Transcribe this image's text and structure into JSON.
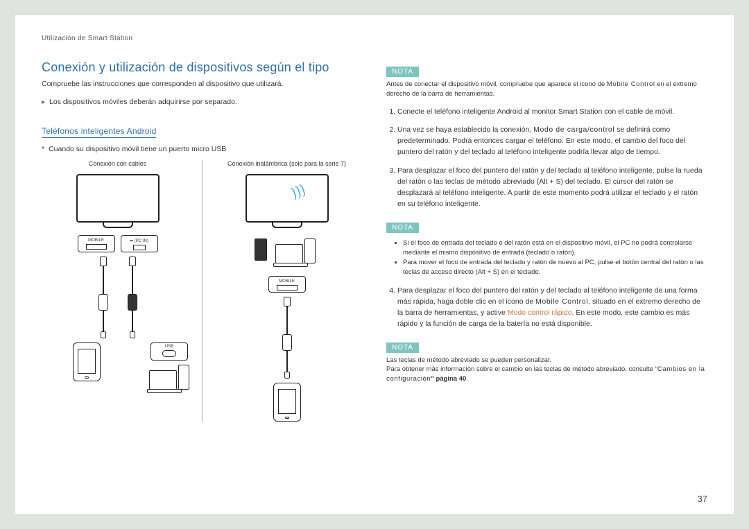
{
  "header": {
    "breadcrumb": "Utilización de Smart Station"
  },
  "left": {
    "title": "Conexión y utilización de dispositivos según el tipo",
    "intro": "Compruebe las instrucciones que corresponden al dispositivo que utilizará.",
    "bullet1": "Los dispositivos móviles deberán adquirirse por separado.",
    "sub_heading": "Teléfonos inteligentes Android",
    "star_note": "Cuando su dispositivo móvil tiene un puerto micro USB",
    "col1_caption": "Conexión con cables",
    "col2_caption": "Conexión inalámbrica (solo para la serie 7)",
    "port_mobile": "MOBILE",
    "port_pcin": "(PC IN)",
    "port_usb_icon": "⬌",
    "usb_label": "USB"
  },
  "right": {
    "note_label": "NOTA",
    "note1_a": "Antes de conectar el dispositivo móvil, compruebe que aparece el icono de ",
    "note1_b": "Mobile Control",
    "note1_c": " en el extremo derecho de la barra de herramientas.",
    "steps": {
      "s1": "Conecte el teléfono inteligente Android al monitor Smart Station con el cable de móvil.",
      "s2_a": "Una vez se haya establecido la conexión, ",
      "s2_b": "Modo de carga/control",
      "s2_c": " se definirá como predeterminado. Podrá entonces cargar el teléfono. En este modo, el cambio del foco del puntero del ratón y del teclado al teléfono inteligente podría llevar algo de tiempo.",
      "s3": "Para desplazar el foco del puntero del ratón y del teclado al teléfono inteligente, pulse la rueda del ratón o las teclas de método abreviado (Alt + S) del teclado. El cursor del ratón se desplazará al teléfono inteligente. A partir de este momento podrá utilizar el teclado y el ratón en su teléfono inteligente.",
      "s4_a": "Para desplazar el foco del puntero del ratón y del teclado al teléfono inteligente de una forma más rápida, haga doble clic en el icono de ",
      "s4_b": "Mobile Control",
      "s4_c": ", situado en el extremo derecho de la barra de herramientas, y active ",
      "s4_d": "Modo control rápido",
      "s4_e": ". En este modo, este cambio es más rápido y la función de carga de la batería no está disponible."
    },
    "note2_b1": "Si el foco de entrada del teclado o del ratón está en el dispositivo móvil, el PC no podrá controlarse mediante el mismo dispositivo de entrada (teclado o ratón).",
    "note2_b2": "Para mover el foco de entrada del teclado y ratón de nuevo al PC, pulse el botón central del ratón o las teclas de acceso directo (Alt + S) en el teclado.",
    "note3_line1": "Las teclas de método abreviado se pueden personalizar.",
    "note3_line2_a": "Para obtener más información sobre el cambio en las teclas de método abreviado, consulte \"",
    "note3_line2_b": "Cambios en la configuración",
    "note3_line2_c": "\" página 40",
    "note3_line2_d": "."
  },
  "page_number": "37"
}
